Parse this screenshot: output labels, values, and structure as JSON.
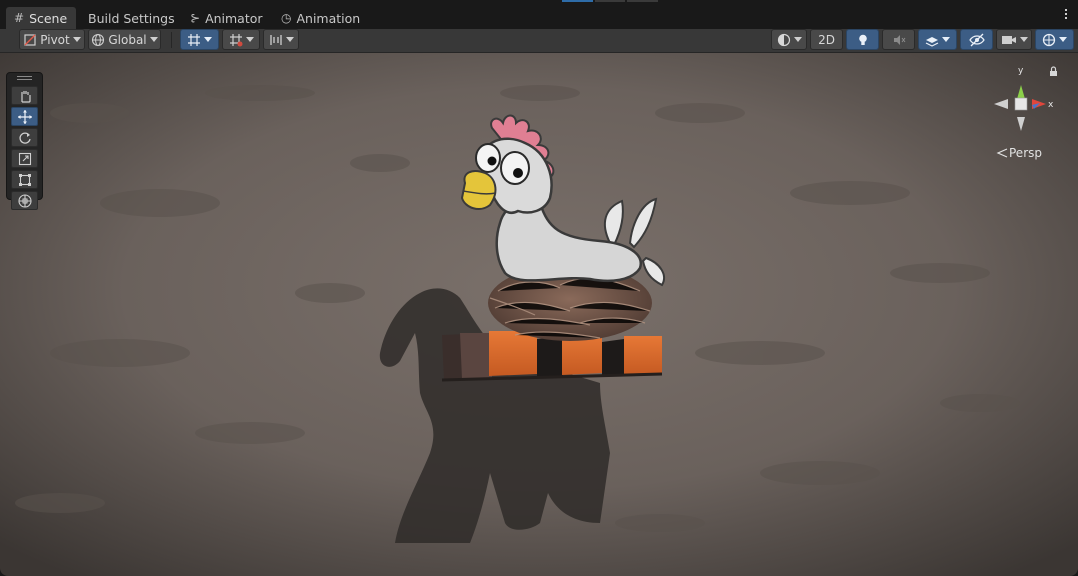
{
  "tabs": [
    {
      "label": "Scene",
      "icon": "grid-icon",
      "active": true
    },
    {
      "label": "Build Settings",
      "icon": "",
      "active": false
    },
    {
      "label": "Animator",
      "icon": "animator-icon",
      "active": false
    },
    {
      "label": "Animation",
      "icon": "clock-icon",
      "active": false
    }
  ],
  "toolbar": {
    "pivot_label": "Pivot",
    "global_label": "Global",
    "mode_2d_label": "2D"
  },
  "tools": [
    "hand-tool",
    "move-tool",
    "rotate-tool",
    "scale-tool",
    "rect-tool",
    "transform-tool"
  ],
  "active_tool": "move-tool",
  "gizmo": {
    "x_label": "x",
    "y_label": "y",
    "projection_label": "Persp"
  },
  "colors": {
    "accent": "#3c5d85",
    "ground": "#6f6560",
    "gizmo_x": "#e0463c",
    "gizmo_y": "#8cd14a"
  }
}
